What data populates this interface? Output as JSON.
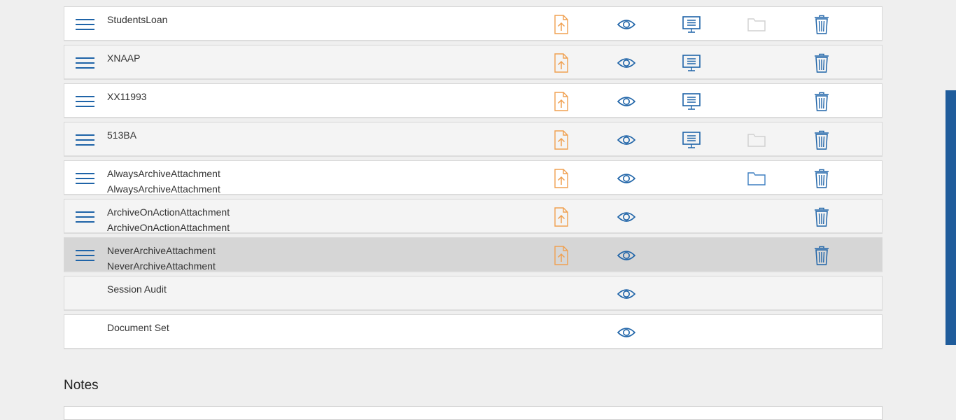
{
  "rows": [
    {
      "lines": [
        "StudentsLoan"
      ],
      "style": "white",
      "icons": {
        "upload": true,
        "view": true,
        "present": true,
        "folder": "empty",
        "delete": true
      }
    },
    {
      "lines": [
        "XNAAP"
      ],
      "style": "alt",
      "icons": {
        "upload": true,
        "view": true,
        "present": true,
        "folder": "none",
        "delete": true
      }
    },
    {
      "lines": [
        "XX11993"
      ],
      "style": "white",
      "icons": {
        "upload": true,
        "view": true,
        "present": true,
        "folder": "none",
        "delete": true
      }
    },
    {
      "lines": [
        "513BA"
      ],
      "style": "alt",
      "icons": {
        "upload": true,
        "view": true,
        "present": true,
        "folder": "empty",
        "delete": true
      }
    },
    {
      "lines": [
        "AlwaysArchiveAttachment",
        "AlwaysArchiveAttachment"
      ],
      "style": "white",
      "icons": {
        "upload": true,
        "view": true,
        "present": false,
        "folder": "active",
        "delete": true
      }
    },
    {
      "lines": [
        "ArchiveOnActionAttachment",
        "ArchiveOnActionAttachment"
      ],
      "style": "alt",
      "icons": {
        "upload": true,
        "view": true,
        "present": false,
        "folder": "none",
        "delete": true
      }
    },
    {
      "lines": [
        "NeverArchiveAttachment",
        "NeverArchiveAttachment"
      ],
      "style": "selected",
      "icons": {
        "upload": true,
        "view": true,
        "present": false,
        "folder": "none",
        "delete": true
      }
    },
    {
      "lines": [
        "Session Audit"
      ],
      "style": "alt",
      "noHandle": true,
      "icons": {
        "upload": false,
        "view": true,
        "present": false,
        "folder": "none",
        "delete": false
      }
    },
    {
      "lines": [
        "Document Set"
      ],
      "style": "white",
      "noHandle": true,
      "icons": {
        "upload": false,
        "view": true,
        "present": false,
        "folder": "none",
        "delete": false
      }
    }
  ],
  "notes": {
    "title": "Notes"
  },
  "icons": {
    "handle": "drag-handle-icon",
    "upload": "upload-file-icon",
    "view": "eye-icon",
    "present": "presentation-icon",
    "folder": "folder-icon",
    "delete": "trash-icon"
  },
  "colors": {
    "blue": "#1f64a8",
    "orange": "#f0a050",
    "folder_active": "#3e7fc1",
    "folder_empty": "#d0d0d0",
    "scrollbar": "#1f5c9b"
  }
}
